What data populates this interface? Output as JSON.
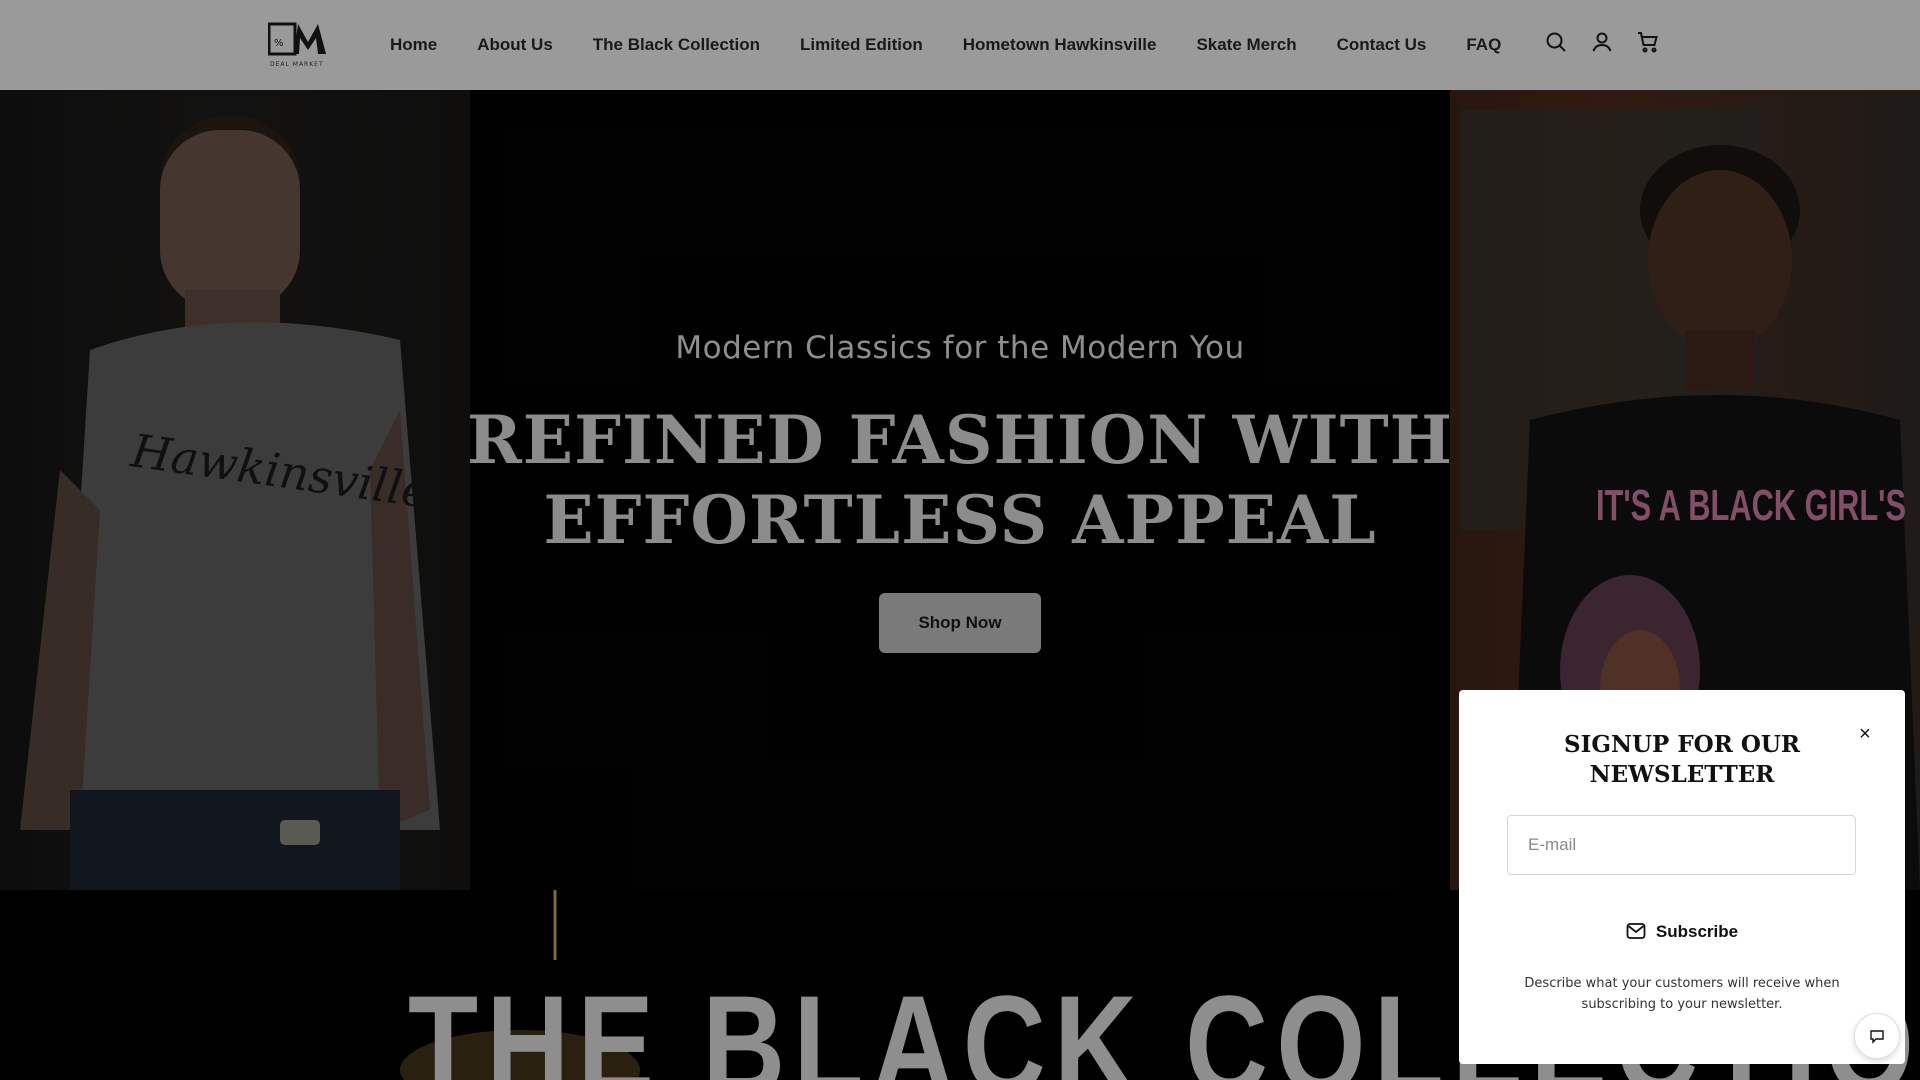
{
  "brand": {
    "logo_text": "DM",
    "logo_subtext": "DEAL MARKET"
  },
  "nav": {
    "items": [
      {
        "label": "Home"
      },
      {
        "label": "About Us"
      },
      {
        "label": "The Black Collection"
      },
      {
        "label": "Limited Edition"
      },
      {
        "label": "Hometown Hawkinsville"
      },
      {
        "label": "Skate Merch"
      },
      {
        "label": "Contact Us"
      },
      {
        "label": "FAQ"
      }
    ]
  },
  "header_icons": [
    "search-icon",
    "account-icon",
    "cart-icon"
  ],
  "hero": {
    "subtitle": "Modern Classics for the Modern You",
    "title_line1": "REFINED FASHION WITH",
    "title_line2": "EFFORTLESS APPEAL",
    "cta_label": "Shop Now",
    "left_shirt_text": "Hawkinsville",
    "right_shirt_text": "IT'S A BLACK GIRL'S"
  },
  "collection": {
    "title": "THE BLACK COLLECTION"
  },
  "newsletter": {
    "title_line1": "SIGNUP FOR OUR",
    "title_line2": "NEWSLETTER",
    "email_placeholder": "E-mail",
    "subscribe_label": "Subscribe",
    "description": "Describe what your customers will receive when subscribing to your newsletter.",
    "close_symbol": "×"
  },
  "colors": {
    "header_bg": "#9a9a9a",
    "button_bg": "#7a7a7a",
    "hero_text": "#8c8c8c"
  }
}
